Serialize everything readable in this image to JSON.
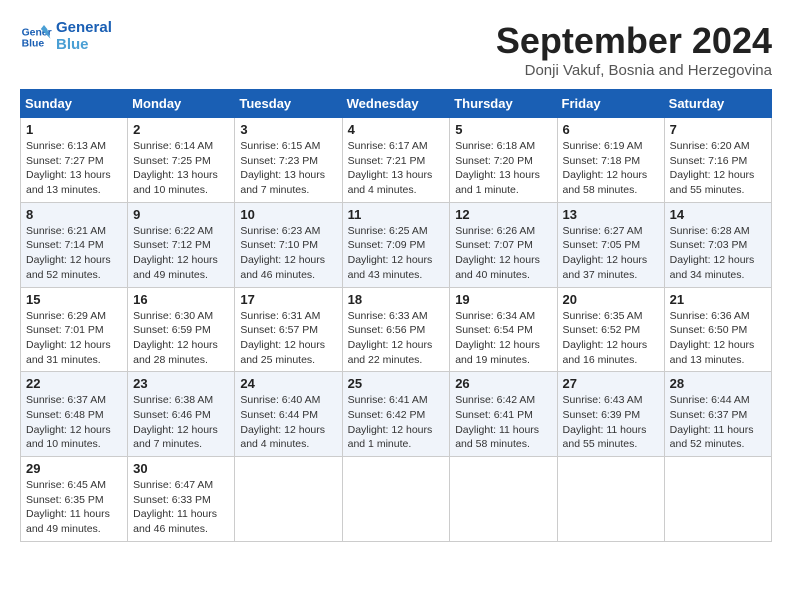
{
  "logo": {
    "line1": "General",
    "line2": "Blue"
  },
  "title": "September 2024",
  "subtitle": "Donji Vakuf, Bosnia and Herzegovina",
  "days_of_week": [
    "Sunday",
    "Monday",
    "Tuesday",
    "Wednesday",
    "Thursday",
    "Friday",
    "Saturday"
  ],
  "weeks": [
    [
      {
        "day": "1",
        "info": "Sunrise: 6:13 AM\nSunset: 7:27 PM\nDaylight: 13 hours\nand 13 minutes."
      },
      {
        "day": "2",
        "info": "Sunrise: 6:14 AM\nSunset: 7:25 PM\nDaylight: 13 hours\nand 10 minutes."
      },
      {
        "day": "3",
        "info": "Sunrise: 6:15 AM\nSunset: 7:23 PM\nDaylight: 13 hours\nand 7 minutes."
      },
      {
        "day": "4",
        "info": "Sunrise: 6:17 AM\nSunset: 7:21 PM\nDaylight: 13 hours\nand 4 minutes."
      },
      {
        "day": "5",
        "info": "Sunrise: 6:18 AM\nSunset: 7:20 PM\nDaylight: 13 hours\nand 1 minute."
      },
      {
        "day": "6",
        "info": "Sunrise: 6:19 AM\nSunset: 7:18 PM\nDaylight: 12 hours\nand 58 minutes."
      },
      {
        "day": "7",
        "info": "Sunrise: 6:20 AM\nSunset: 7:16 PM\nDaylight: 12 hours\nand 55 minutes."
      }
    ],
    [
      {
        "day": "8",
        "info": "Sunrise: 6:21 AM\nSunset: 7:14 PM\nDaylight: 12 hours\nand 52 minutes."
      },
      {
        "day": "9",
        "info": "Sunrise: 6:22 AM\nSunset: 7:12 PM\nDaylight: 12 hours\nand 49 minutes."
      },
      {
        "day": "10",
        "info": "Sunrise: 6:23 AM\nSunset: 7:10 PM\nDaylight: 12 hours\nand 46 minutes."
      },
      {
        "day": "11",
        "info": "Sunrise: 6:25 AM\nSunset: 7:09 PM\nDaylight: 12 hours\nand 43 minutes."
      },
      {
        "day": "12",
        "info": "Sunrise: 6:26 AM\nSunset: 7:07 PM\nDaylight: 12 hours\nand 40 minutes."
      },
      {
        "day": "13",
        "info": "Sunrise: 6:27 AM\nSunset: 7:05 PM\nDaylight: 12 hours\nand 37 minutes."
      },
      {
        "day": "14",
        "info": "Sunrise: 6:28 AM\nSunset: 7:03 PM\nDaylight: 12 hours\nand 34 minutes."
      }
    ],
    [
      {
        "day": "15",
        "info": "Sunrise: 6:29 AM\nSunset: 7:01 PM\nDaylight: 12 hours\nand 31 minutes."
      },
      {
        "day": "16",
        "info": "Sunrise: 6:30 AM\nSunset: 6:59 PM\nDaylight: 12 hours\nand 28 minutes."
      },
      {
        "day": "17",
        "info": "Sunrise: 6:31 AM\nSunset: 6:57 PM\nDaylight: 12 hours\nand 25 minutes."
      },
      {
        "day": "18",
        "info": "Sunrise: 6:33 AM\nSunset: 6:56 PM\nDaylight: 12 hours\nand 22 minutes."
      },
      {
        "day": "19",
        "info": "Sunrise: 6:34 AM\nSunset: 6:54 PM\nDaylight: 12 hours\nand 19 minutes."
      },
      {
        "day": "20",
        "info": "Sunrise: 6:35 AM\nSunset: 6:52 PM\nDaylight: 12 hours\nand 16 minutes."
      },
      {
        "day": "21",
        "info": "Sunrise: 6:36 AM\nSunset: 6:50 PM\nDaylight: 12 hours\nand 13 minutes."
      }
    ],
    [
      {
        "day": "22",
        "info": "Sunrise: 6:37 AM\nSunset: 6:48 PM\nDaylight: 12 hours\nand 10 minutes."
      },
      {
        "day": "23",
        "info": "Sunrise: 6:38 AM\nSunset: 6:46 PM\nDaylight: 12 hours\nand 7 minutes."
      },
      {
        "day": "24",
        "info": "Sunrise: 6:40 AM\nSunset: 6:44 PM\nDaylight: 12 hours\nand 4 minutes."
      },
      {
        "day": "25",
        "info": "Sunrise: 6:41 AM\nSunset: 6:42 PM\nDaylight: 12 hours\nand 1 minute."
      },
      {
        "day": "26",
        "info": "Sunrise: 6:42 AM\nSunset: 6:41 PM\nDaylight: 11 hours\nand 58 minutes."
      },
      {
        "day": "27",
        "info": "Sunrise: 6:43 AM\nSunset: 6:39 PM\nDaylight: 11 hours\nand 55 minutes."
      },
      {
        "day": "28",
        "info": "Sunrise: 6:44 AM\nSunset: 6:37 PM\nDaylight: 11 hours\nand 52 minutes."
      }
    ],
    [
      {
        "day": "29",
        "info": "Sunrise: 6:45 AM\nSunset: 6:35 PM\nDaylight: 11 hours\nand 49 minutes."
      },
      {
        "day": "30",
        "info": "Sunrise: 6:47 AM\nSunset: 6:33 PM\nDaylight: 11 hours\nand 46 minutes."
      },
      {
        "day": "",
        "info": ""
      },
      {
        "day": "",
        "info": ""
      },
      {
        "day": "",
        "info": ""
      },
      {
        "day": "",
        "info": ""
      },
      {
        "day": "",
        "info": ""
      }
    ]
  ]
}
